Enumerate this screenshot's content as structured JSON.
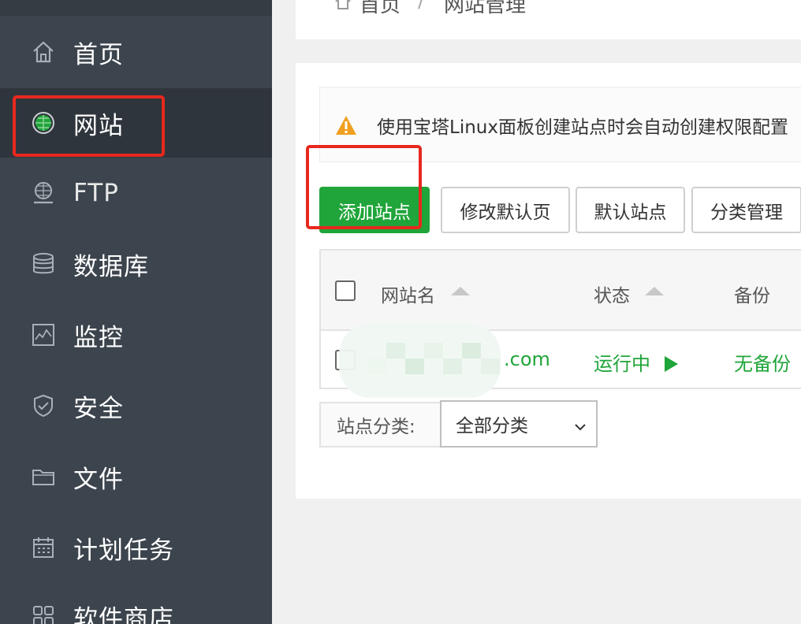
{
  "breadcrumb": {
    "home": "首页",
    "separator": "/",
    "current": "网站管理"
  },
  "sidebar": {
    "items": [
      {
        "label": "首页",
        "icon": "home-icon"
      },
      {
        "label": "网站",
        "icon": "globe-icon",
        "active": true
      },
      {
        "label": "FTP",
        "icon": "ftp-icon"
      },
      {
        "label": "数据库",
        "icon": "database-icon"
      },
      {
        "label": "监控",
        "icon": "monitor-icon"
      },
      {
        "label": "安全",
        "icon": "shield-icon"
      },
      {
        "label": "文件",
        "icon": "folder-icon"
      },
      {
        "label": "计划任务",
        "icon": "calendar-icon"
      },
      {
        "label": "软件商店",
        "icon": "grid-icon"
      }
    ]
  },
  "notice": {
    "text": "使用宝塔Linux面板创建站点时会自动创建权限配置"
  },
  "toolbar": {
    "add_site": "添加站点",
    "edit_default_page": "修改默认页",
    "default_site": "默认站点",
    "category_manage": "分类管理"
  },
  "table": {
    "headers": {
      "site_name": "网站名",
      "status": "状态",
      "backup": "备份"
    },
    "rows": [
      {
        "site_name_visible": ".com",
        "status": "运行中",
        "backup": "无备份"
      }
    ]
  },
  "filter": {
    "label": "站点分类:",
    "selected": "全部分类"
  },
  "colors": {
    "accent_green": "#20a53a",
    "sidebar_bg": "#3c444d",
    "highlight_red": "#e8281e"
  }
}
